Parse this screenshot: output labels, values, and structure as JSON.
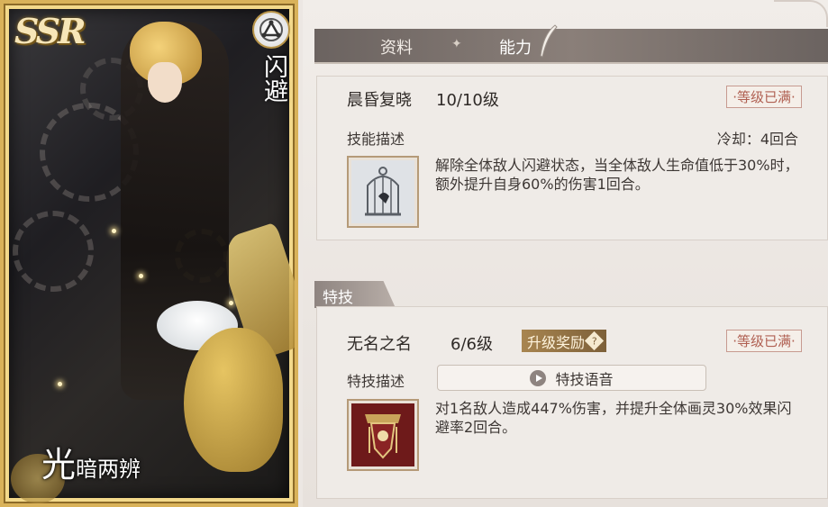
{
  "card": {
    "rarity": "SSR",
    "class_name": "闪避",
    "name_first_char": "光",
    "name_rest": "暗两辨"
  },
  "tabs": {
    "info": "资料",
    "ability": "能力"
  },
  "skill": {
    "name": "晨昏复晓",
    "level": "10/10级",
    "maxed": "·等级已满·",
    "desc_label": "技能描述",
    "cooldown": "冷却：4回合",
    "description": "解除全体敌人闪避状态，当全体敌人生命值低于30%时，额外提升自身60%的伤害1回合。",
    "icon": "birdcage-icon"
  },
  "technique": {
    "tab_label": "特技",
    "name": "无名之名",
    "level": "6/6级",
    "reward": "升级奖励",
    "reward_icon": "question-icon",
    "maxed": "·等级已满·",
    "desc_label": "特技描述",
    "voice_label": "特技语音",
    "description": "对1名敌人造成447%伤害，并提升全体画灵30%效果闪避率2回合。",
    "icon": "crest-banner-icon"
  },
  "colors": {
    "card_frame": "#d9b25a",
    "maxed_text": "#b06052",
    "reward_bg": "#a88550",
    "tabbar": "#7a706b"
  }
}
